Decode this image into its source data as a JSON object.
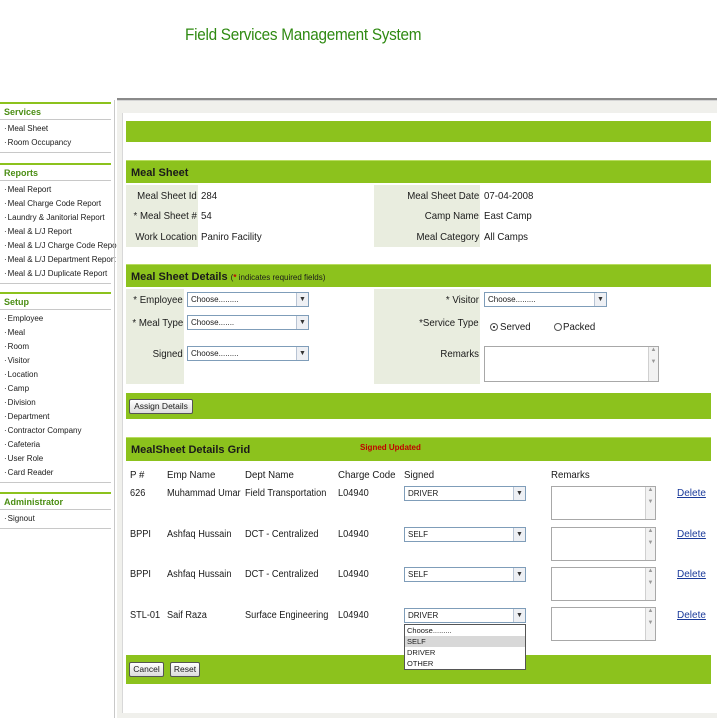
{
  "app": {
    "title": "Field Services Management System"
  },
  "sidebar": {
    "services": {
      "title": "Services",
      "items": [
        "Meal Sheet",
        "Room Occupancy"
      ]
    },
    "reports": {
      "title": "Reports",
      "items": [
        "Meal Report",
        "Meal Charge Code Report",
        "Laundry & Janitorial Report",
        "Meal & L/J Report",
        "Meal & L/J Charge Code Report",
        "Meal & L/J Department Report",
        "Meal & L/J Duplicate Report"
      ]
    },
    "setup": {
      "title": "Setup",
      "items": [
        "Employee",
        "Meal",
        "Room",
        "Visitor",
        "Location",
        "Camp",
        "Division",
        "Department",
        "Contractor Company",
        "Cafeteria",
        "User Role",
        "Card Reader"
      ]
    },
    "administrator": {
      "title": "Administrator",
      "items": [
        "Signout"
      ]
    }
  },
  "meal_sheet": {
    "title": "Meal Sheet",
    "id_label": "Meal Sheet Id",
    "id_value": "284",
    "num_label": "* Meal Sheet #",
    "num_value": "54",
    "location_label": "Work Location",
    "location_value": "Paniro Facility",
    "date_label": "Meal Sheet Date",
    "date_value": "07-04-2008",
    "camp_label": "Camp Name",
    "camp_value": "East Camp",
    "category_label": "Meal Category",
    "category_value": "All Camps"
  },
  "details": {
    "title": "Meal Sheet Details",
    "note_prefix": "(",
    "note_star": "*",
    "note_text": " indicates required fields)",
    "employee_label": "* Employee",
    "employee_value": "Choose.........",
    "mealtype_label": "* Meal Type",
    "mealtype_value": "Choose.......",
    "signed_label": "Signed",
    "signed_value": "Choose.........",
    "visitor_label": "* Visitor",
    "visitor_value": "Choose.........",
    "service_label": "*Service Type",
    "served_label": "Served",
    "packed_label": "Packed",
    "remarks_label": "Remarks",
    "assign_button": "Assign Details"
  },
  "grid": {
    "title": "MealSheet Details Grid",
    "status": "Signed Updated",
    "headers": [
      "P #",
      "Emp Name",
      "Dept Name",
      "Charge Code",
      "Signed",
      "Remarks"
    ],
    "rows": [
      {
        "p": "626",
        "emp": "Muhammad Umar",
        "dept": "Field Transportation",
        "code": "L04940",
        "signed": "DRIVER",
        "action": "Delete"
      },
      {
        "p": "BPPI",
        "emp": "Ashfaq Hussain",
        "dept": "DCT - Centralized",
        "code": "L04940",
        "signed": "SELF",
        "action": "Delete"
      },
      {
        "p": "BPPI",
        "emp": "Ashfaq Hussain",
        "dept": "DCT - Centralized",
        "code": "L04940",
        "signed": "SELF",
        "action": "Delete"
      },
      {
        "p": "STL-01",
        "emp": "Saif Raza",
        "dept": "Surface Engineering",
        "code": "L04940",
        "signed": "DRIVER",
        "action": "Delete"
      }
    ],
    "dropdown_options": [
      "Choose.........",
      "SELF",
      "DRIVER",
      "OTHER"
    ],
    "cancel_button": "Cancel",
    "reset_button": "Reset"
  },
  "colors": {
    "accent": "#8cc21d",
    "title": "#2f8a12",
    "label_bg": "#e9eddf"
  }
}
